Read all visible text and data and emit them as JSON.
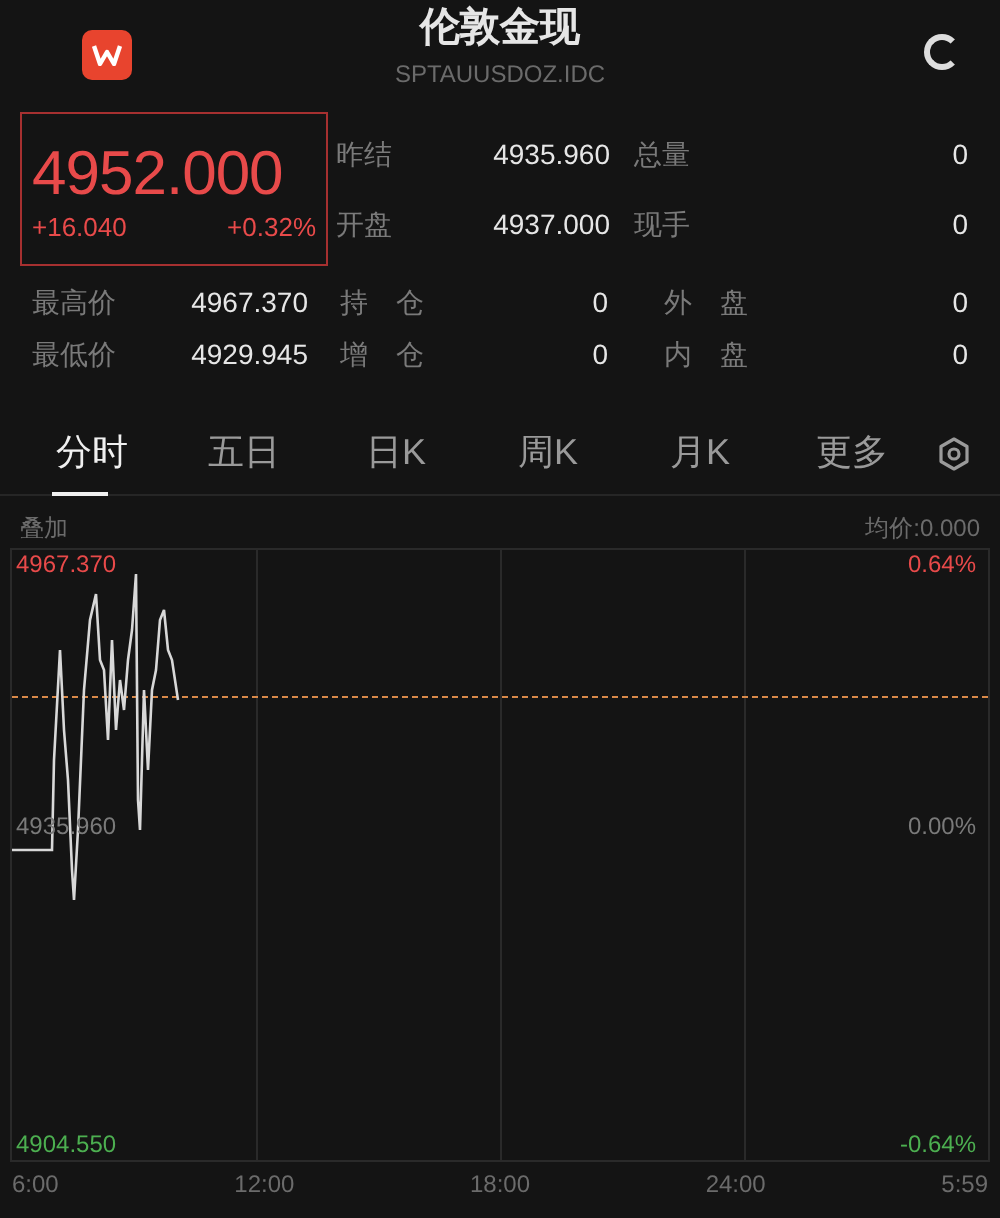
{
  "header": {
    "title": "伦敦金现",
    "code": "SPTAUUSDOZ.IDC"
  },
  "quote": {
    "price": "4952.000",
    "change": "+16.040",
    "change_pct": "+0.32%"
  },
  "top_stats": [
    [
      {
        "label": "昨结",
        "value": "4935.960"
      },
      {
        "label": "总量",
        "value": "0"
      }
    ],
    [
      {
        "label": "开盘",
        "value": "4937.000"
      },
      {
        "label": "现手",
        "value": "0"
      }
    ]
  ],
  "bottom_stats": [
    [
      {
        "label": "最高价",
        "value": "4967.370"
      },
      {
        "label": "持　仓",
        "value": "0"
      },
      {
        "label": "外　盘",
        "value": "0"
      }
    ],
    [
      {
        "label": "最低价",
        "value": "4929.945"
      },
      {
        "label": "增　仓",
        "value": "0"
      },
      {
        "label": "内　盘",
        "value": "0"
      }
    ]
  ],
  "tabs": [
    {
      "label": "分时",
      "selected": true
    },
    {
      "label": "五日",
      "selected": false
    },
    {
      "label": "日K",
      "selected": false
    },
    {
      "label": "周K",
      "selected": false
    },
    {
      "label": "月K",
      "selected": false
    },
    {
      "label": "更多",
      "selected": false
    }
  ],
  "chart": {
    "overlay": "叠加",
    "avg_price": "均价:0.000",
    "high": "4967.370",
    "high_pct": "0.64%",
    "mid": "4935.960",
    "mid_pct": "0.00%",
    "low": "4904.550",
    "low_pct": "-0.64%",
    "times": [
      "6:00",
      "12:00",
      "18:00",
      "24:00",
      "5:59"
    ]
  }
}
